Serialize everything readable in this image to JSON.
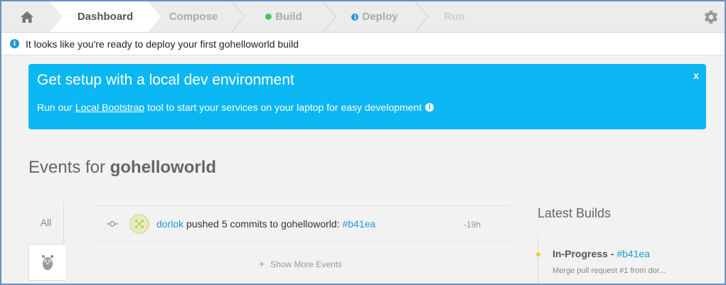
{
  "nav": {
    "steps": [
      {
        "label": "Dashboard",
        "state": "active"
      },
      {
        "label": "Compose",
        "state": "inactive"
      },
      {
        "label": "Build",
        "state": "inactive",
        "indicator": "green-dot"
      },
      {
        "label": "Deploy",
        "state": "inactive",
        "indicator": "info-dot"
      },
      {
        "label": "Run",
        "state": "disabled"
      }
    ],
    "home_icon": "home-icon",
    "settings_icon": "gear-icon"
  },
  "notice": {
    "icon": "info-icon",
    "text": "It looks like you're ready to deploy your first gohelloworld build"
  },
  "banner": {
    "title": "Get setup with a local dev environment",
    "close_label": "x",
    "text_before": "Run our",
    "link_label": "Local Bootstrap",
    "text_after": "tool to start your services on your laptop for easy development",
    "info_icon": "info-icon",
    "color": "#0ab7f2"
  },
  "events": {
    "heading_prefix": "Events for",
    "app_name": "gohelloworld",
    "tabs": {
      "all_label": "All",
      "app_icon": "gopher-icon"
    },
    "items": [
      {
        "icon": "commit-icon",
        "user": "dorlok",
        "action": "pushed 5 commits to gohelloworld:",
        "commit": "#b41ea",
        "time": "-19h"
      }
    ],
    "show_more_label": "Show More Events"
  },
  "builds": {
    "title": "Latest Builds",
    "items": [
      {
        "status": "In-Progress",
        "separator": "-",
        "commit": "#b41ea",
        "message": "Merge pull request #1 from dor...",
        "status_color": "#f5c542"
      }
    ]
  },
  "colors": {
    "accent": "#1f9ad6",
    "build_green": "#3fc85d"
  }
}
